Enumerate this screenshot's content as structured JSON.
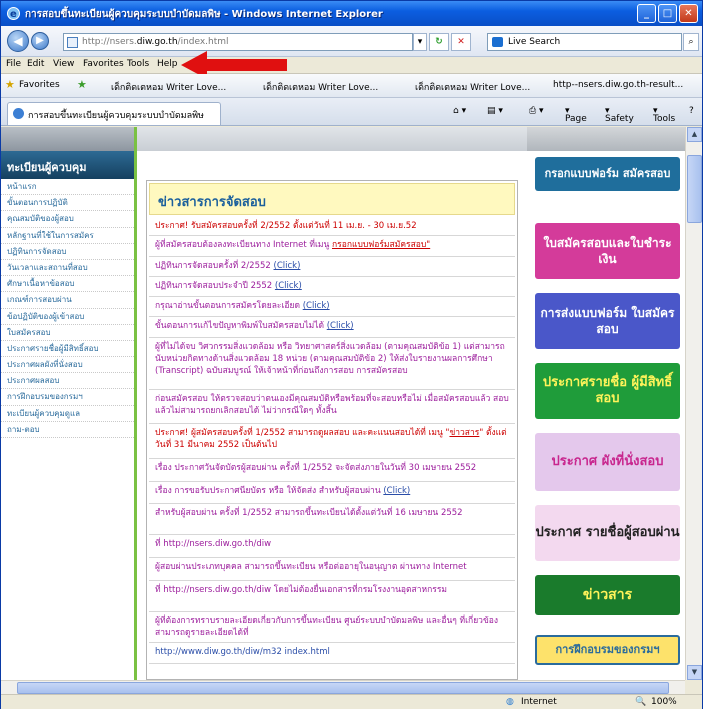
{
  "window": {
    "title": "การสอบขึ้นทะเบียนผู้ควบคุมระบบบำบัดมลพิษ - Windows Internet Explorer",
    "minimize": "_",
    "maximize": "□",
    "close": "✕"
  },
  "address": {
    "url_prefix": "http://nsers.",
    "url_domain": "diw.go.th",
    "url_suffix": "/index.html",
    "search_label": "Live Search"
  },
  "menu": [
    "File",
    "Edit",
    "View",
    "Favorites",
    "Tools",
    "Help"
  ],
  "favorites": {
    "label": "Favorites",
    "items": [
      "เด็กติดเตหอม Writer Love...",
      "เด็กติดเตหอม Writer Love...",
      "เด็กติดเตหอม Writer Love...",
      "http--nsers.diw.go.th-result..."
    ]
  },
  "tab": {
    "label": "การสอบขึ้นทะเบียนผู้ควบคุมระบบบำบัดมลพิษ",
    "page": "Page",
    "safety": "Safety",
    "tools": "Tools"
  },
  "sidebar": {
    "heading": "ทะเบียนผู้ควบคุม",
    "items": [
      "หน้าแรก",
      "ขั้นตอนการปฏิบัติ",
      "คุณสมบัติของผู้สอบ",
      "หลักฐานที่ใช้ในการสมัคร",
      "ปฏิทินการจัดสอบ",
      "วันเวลาและสถานที่สอบ",
      "ศักษาเนื้อหาข้อสอบ",
      "เกณฑ์การสอบผ่าน",
      "ข้อปฏิบัติของผู้เข้าสอบ",
      "ใบสมัครสอบ",
      "ประกาศรายชื่อผู้มีสิทธิ์สอบ",
      "ประกาศผลผังที่นั่งสอบ",
      "ประกาศผลสอบ",
      "การฝึกอบรมของกรมฯ",
      "ทะเบียนผู้ควบคุมดูแล",
      "ถาม-ตอบ"
    ]
  },
  "news": {
    "heading": "ข่าวสารการจัดสอบ",
    "items": [
      {
        "text": "ประกาศ! รับสมัครสอบครั้งที่ 2/2552 ตั้งแต่วันที่ 11 เม.ย. - 30 เม.ย.52",
        "link": "",
        "color": "#cc0000"
      },
      {
        "text": "ผู้ที่สมัครสอบต้องลงทะเบียนทาง Internet ที่เมนู ",
        "link": "กรอกแบบฟอร์มสมัครสอบ\"",
        "color": "#9c1d9c"
      },
      {
        "text": "ปฏิทินการจัดสอบครั้งที่ 2/2552 ",
        "link": "(Click)",
        "color": "#9c1d9c"
      },
      {
        "text": "ปฏิทินการจัดสอบประจำปี 2552 ",
        "link": "(Click)",
        "color": "#9c1d9c"
      },
      {
        "text": "กรุณาอ่านขั้นตอนการสมัครโดยละเอียด ",
        "link": "(Click)",
        "color": "#9c1d9c"
      },
      {
        "text": "ขั้นตอนการแก้ไขปัญหาพิมพ์ใบสมัครสอบไม่ได้ ",
        "link": "(Click)",
        "color": "#9c1d9c"
      },
      {
        "text": "ผู้ที่ไม่ได้จบ วิศวกรรมสิ่งแวดล้อม หรือ วิทยาศาสตร์สิ่งแวดล้อม (ตามคุณสมบัติข้อ 1) แต่สามารถนับหน่วยกิตทางด้านสิ่งแวดล้อม 18 หน่วย (ตามคุณสมบัติข้อ 2) ให้ส่งใบรายงานผลการศึกษา (Transcript) ฉบับสมบูรณ์ ให้เจ้าหน้าที่ก่อนถึงการสอบ การสมัครสอบ",
        "link": "",
        "color": "#9c1d9c"
      },
      {
        "text": "ก่อนสมัครสอบ ให้ตรวจสอบว่าตนเองมีคุณสมบัติหรือพร้อมที่จะสอบหรือไม่ เมื่อสมัครสอบแล้ว สอบแล้วไม่สามารถยกเลิกสอบได้ ไม่ว่ากรณีใดๆ ทั้งสิ้น",
        "link": "",
        "color": "#9c1d9c"
      },
      {
        "text": "ประกาศ! ผู้สมัครสอบครั้งที่ 1/2552 สามารถดูผลสอบ และคะแนนสอบได้ที่ เมนู \"",
        "link": "ข่าวสาร",
        "tail": "\" ตั้งแต่วันที่ 31 มีนาคม 2552 เป็นต้นไป",
        "color": "#cc0000"
      },
      {
        "text": "เรื่อง ประกาศวันจัดบัตรผู้สอบผ่าน ครั้งที่ 1/2552 จะจัดส่งภายในวันที่ 30 เมษายน 2552",
        "link": "",
        "color": "#9c1d9c"
      },
      {
        "text": "เรื่อง การขอรับประกาศนียบัตร หรือ ให้จัดส่ง สำหรับผู้สอบผ่าน ",
        "link": "(Click)",
        "color": "#9c1d9c"
      },
      {
        "text": "สำหรับผู้สอบผ่าน ครั้งที่ 1/2552 สามารถขึ้นทะเบียนได้ตั้งแต่วันที่ 16 เมษายน 2552",
        "link": "",
        "color": "#9c1d9c"
      },
      {
        "text": "ที่ http://nsers.diw.go.th/diw",
        "link": "",
        "color": "#9c1d9c"
      },
      {
        "text": "ผู้สอบผ่านประเภทบุคคล สามารถขึ้นทะเบียน หรือต่ออายุในอนุญาต ผ่านทาง Internet",
        "link": "",
        "color": "#9c1d9c"
      },
      {
        "text": "ที่ http://nsers.diw.go.th/diw โดยไม่ต้องยื่นเอกสารที่กรมโรงงานอุตสาหกรรม",
        "link": "",
        "color": "#9c1d9c"
      },
      {
        "text": "ผู้ที่ต้องการทราบรายละเอียดเกี่ยวกับการขึ้นทะเบียน ศูนย์ระบบบำบัดมลพิษ และอื่นๆ ที่เกี่ยวข้อง สามารถดูรายละเอียดได้ที่",
        "link": "",
        "color": "#9c1d9c"
      },
      {
        "text": "http://www.diw.go.th/diw/m32 index.html",
        "link": "",
        "color": "#2a4da8"
      }
    ]
  },
  "banners": [
    {
      "label": "กรอกแบบฟอร์ม สมัครสอบ",
      "bg": "#1f6e9c",
      "fg": "#ffffff"
    },
    {
      "label": "ใบสมัครสอบและใบชำระเงิน",
      "bg": "#d43b9a",
      "fg": "#ffffff"
    },
    {
      "label": "การส่งแบบฟอร์ม ใบสมัครสอบ",
      "bg": "#4a57c9",
      "fg": "#ffffff"
    },
    {
      "label": "ประกาศรายชื่อ ผู้มีสิทธิ์สอบ",
      "bg": "#1f9c3a",
      "fg": "#fff35a"
    },
    {
      "label": "ประกาศ ผังที่นั่งสอบ",
      "bg": "#e4c8ec",
      "fg": "#c8268e"
    },
    {
      "label": "ประกาศ รายชื่อผู้สอบผ่าน",
      "bg": "#f3d9ef",
      "fg": "#222222"
    },
    {
      "label": "ข่าวสาร",
      "bg": "#1a7b2c",
      "fg": "#fff35a"
    },
    {
      "label": "การฝึกอบรมของกรมฯ",
      "bg": "#fde26b",
      "fg": "#2a6b9c"
    }
  ],
  "status": {
    "zone": "Internet",
    "zoom": "100%"
  },
  "colors": {
    "titlebar": "#0b5ee0",
    "nav_heading": "#1f4f73",
    "news_heading": "#1a5f9c",
    "annotation_arrow": "#e01010"
  }
}
